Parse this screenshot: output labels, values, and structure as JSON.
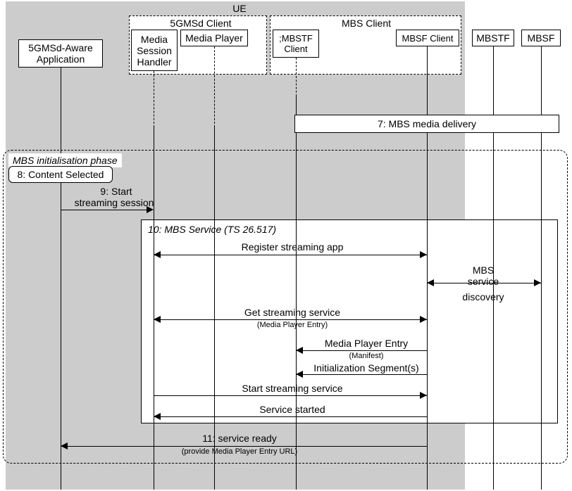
{
  "ue_label": "UE",
  "client_5gmsd": "5GMSd Client",
  "client_mbs": "MBS Client",
  "app": "5GMSd-Aware Application",
  "msh": "Media Session Handler",
  "mplayer": "Media Player",
  "mbstf_client": ";MBSTF Client",
  "mbsf_client": "MBSF Client",
  "mbstf": "MBSTF",
  "mbsf": "MBSF",
  "step7": "7: MBS media delivery",
  "phase": "MBS initialisation phase",
  "step8": "8: Content Selected",
  "step9a": "9: Start",
  "step9b": "streaming session",
  "step10": "10: MBS Service (TS 26.517)",
  "reg": "Register streaming app",
  "mbs_disc1": "MBS",
  "mbs_disc2": "service",
  "mbs_disc3": "discovery",
  "get_svc": "Get streaming service",
  "mpe_sub": "(Media Player Entry)",
  "mpe": "Media Player Entry",
  "manifest": "(Manifest)",
  "init_seg": "Initialization Segment(s)",
  "start_svc": "Start streaming service",
  "svc_started": "Service started",
  "step11": "11: service ready",
  "step11_sub": "(provide Media Player Entry URL)"
}
